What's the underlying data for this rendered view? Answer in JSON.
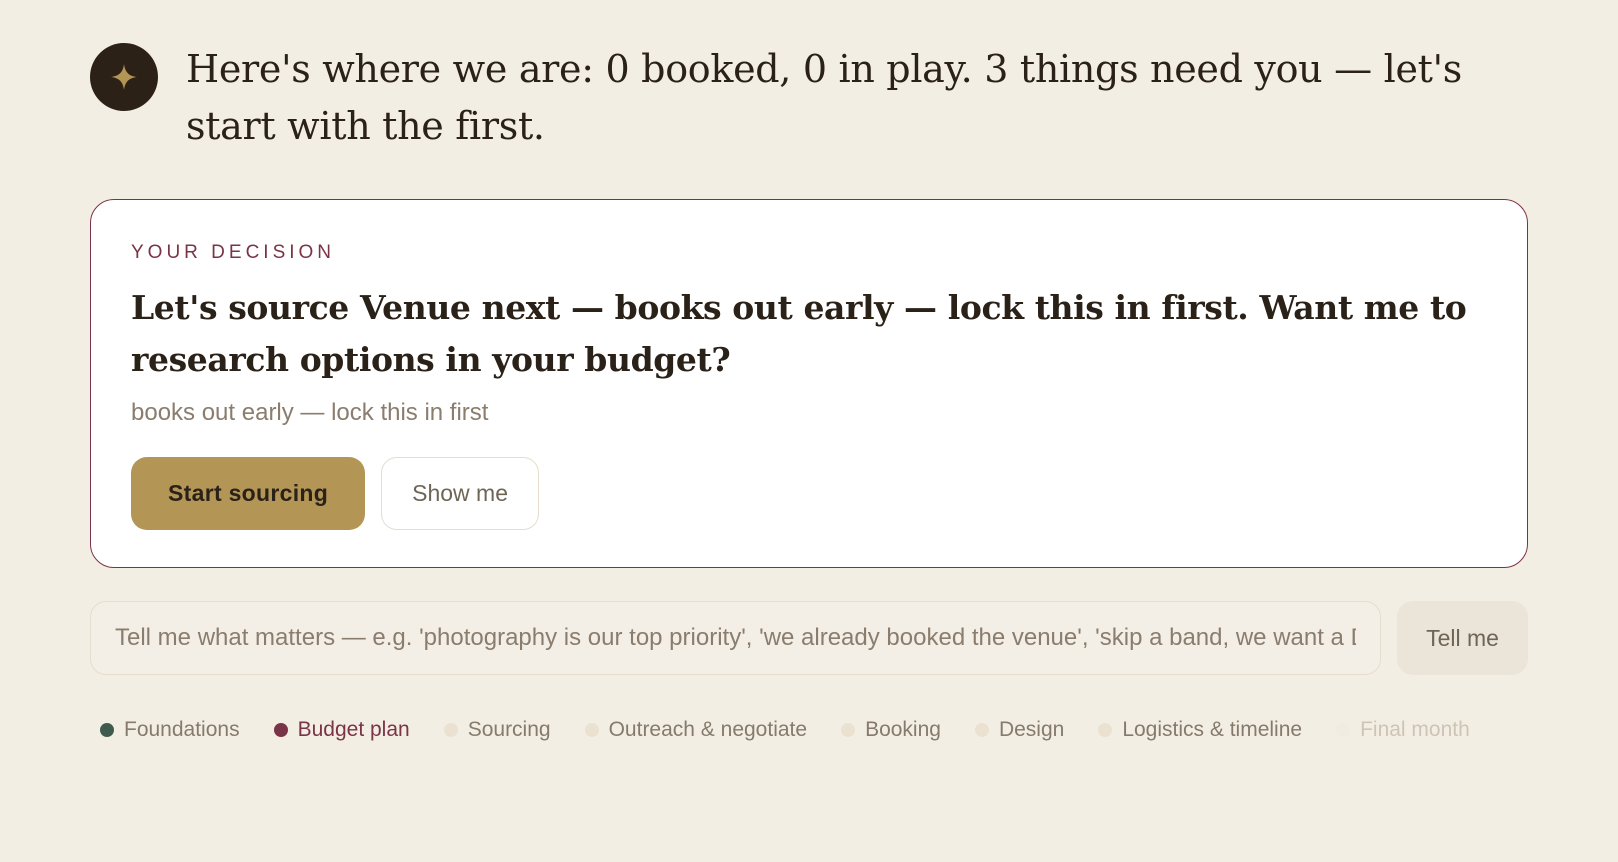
{
  "header": {
    "assistant_icon": "sparkle-icon",
    "headline": "Here's where we are: 0 booked, 0 in play. 3 things need you — let's start with the first."
  },
  "decision_card": {
    "eyebrow": "YOUR DECISION",
    "question": "Let's source Venue next — books out early — lock this in first. Want me to research options in your budget?",
    "subnote": "books out early — lock this in first",
    "primary_button": "Start sourcing",
    "secondary_button": "Show me"
  },
  "input": {
    "placeholder": "Tell me what matters — e.g. 'photography is our top priority', 'we already booked the venue', 'skip a band, we want a DJ'",
    "submit_label": "Tell me"
  },
  "stages": [
    {
      "label": "Foundations",
      "state": "done"
    },
    {
      "label": "Budget plan",
      "state": "active"
    },
    {
      "label": "Sourcing",
      "state": "upcoming"
    },
    {
      "label": "Outreach & negotiate",
      "state": "upcoming"
    },
    {
      "label": "Booking",
      "state": "upcoming"
    },
    {
      "label": "Design",
      "state": "upcoming"
    },
    {
      "label": "Logistics & timeline",
      "state": "upcoming"
    },
    {
      "label": "Final month",
      "state": "faded"
    }
  ],
  "colors": {
    "background": "#f3eee4",
    "accent_gold": "#b39556",
    "accent_plum": "#7a3447",
    "done_green": "#3f5b4f",
    "dark": "#2c2116"
  }
}
